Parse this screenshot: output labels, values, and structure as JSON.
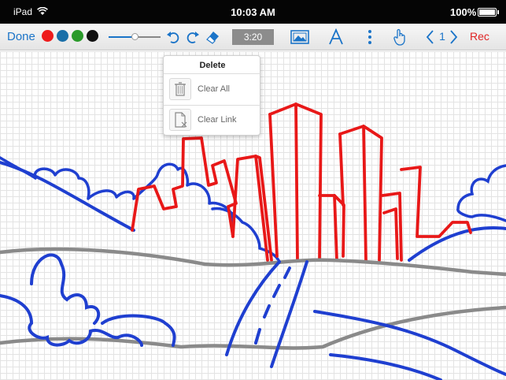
{
  "status_bar": {
    "carrier": "iPad",
    "time": "10:03 AM",
    "battery": "100%"
  },
  "toolbar": {
    "done_label": "Done",
    "colors": [
      "#ee1c1c",
      "#1a6fa8",
      "#2a9a2a",
      "#111111"
    ],
    "stroke_size": 0.5,
    "timer": "3:20",
    "page_number": "1",
    "rec_label": "Rec",
    "icons": [
      "undo-icon",
      "redo-icon",
      "eraser-icon",
      "image-icon",
      "text-icon",
      "more-icon",
      "hand-icon",
      "prev-page-icon",
      "next-page-icon"
    ]
  },
  "popover": {
    "title": "Delete",
    "items": [
      {
        "label": "Clear All",
        "icon": "trash-icon"
      },
      {
        "label": "Clear Link",
        "icon": "clear-link-icon"
      }
    ]
  },
  "drawing": {
    "stroke_colors": {
      "blue": "#1f3fd0",
      "red": "#e81818",
      "gray": "#8a8a8a"
    }
  }
}
